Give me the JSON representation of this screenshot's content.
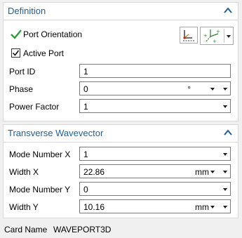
{
  "definition": {
    "title": "Definition",
    "port_orientation_label": "Port Orientation",
    "active_port_label": "Active Port",
    "active_port_checked": true,
    "port_id": {
      "label": "Port ID",
      "value": "1"
    },
    "phase": {
      "label": "Phase",
      "value": "0",
      "unit": "°"
    },
    "power_factor": {
      "label": "Power Factor",
      "value": "1"
    }
  },
  "transverse": {
    "title": "Transverse Wavevector",
    "mode_number_x": {
      "label": "Mode Number X",
      "value": "1"
    },
    "width_x": {
      "label": "Width X",
      "value": "22.86",
      "unit": "mm"
    },
    "mode_number_y": {
      "label": "Mode Number Y",
      "value": "0"
    },
    "width_y": {
      "label": "Width Y",
      "value": "10.16",
      "unit": "mm"
    }
  },
  "footer": {
    "card_name_label": "Card Name",
    "card_name_value": "WAVEPORT3D"
  },
  "colors": {
    "section_title": "#1f5f99",
    "check_green": "#2e9e3a",
    "panel_bg": "#ffffff",
    "window_bg": "#f0f0f0"
  },
  "icons": [
    "collapse-up-icon",
    "checkmark-icon",
    "coordinate-system-icon",
    "vector-axes-icon",
    "chevron-down-icon"
  ]
}
